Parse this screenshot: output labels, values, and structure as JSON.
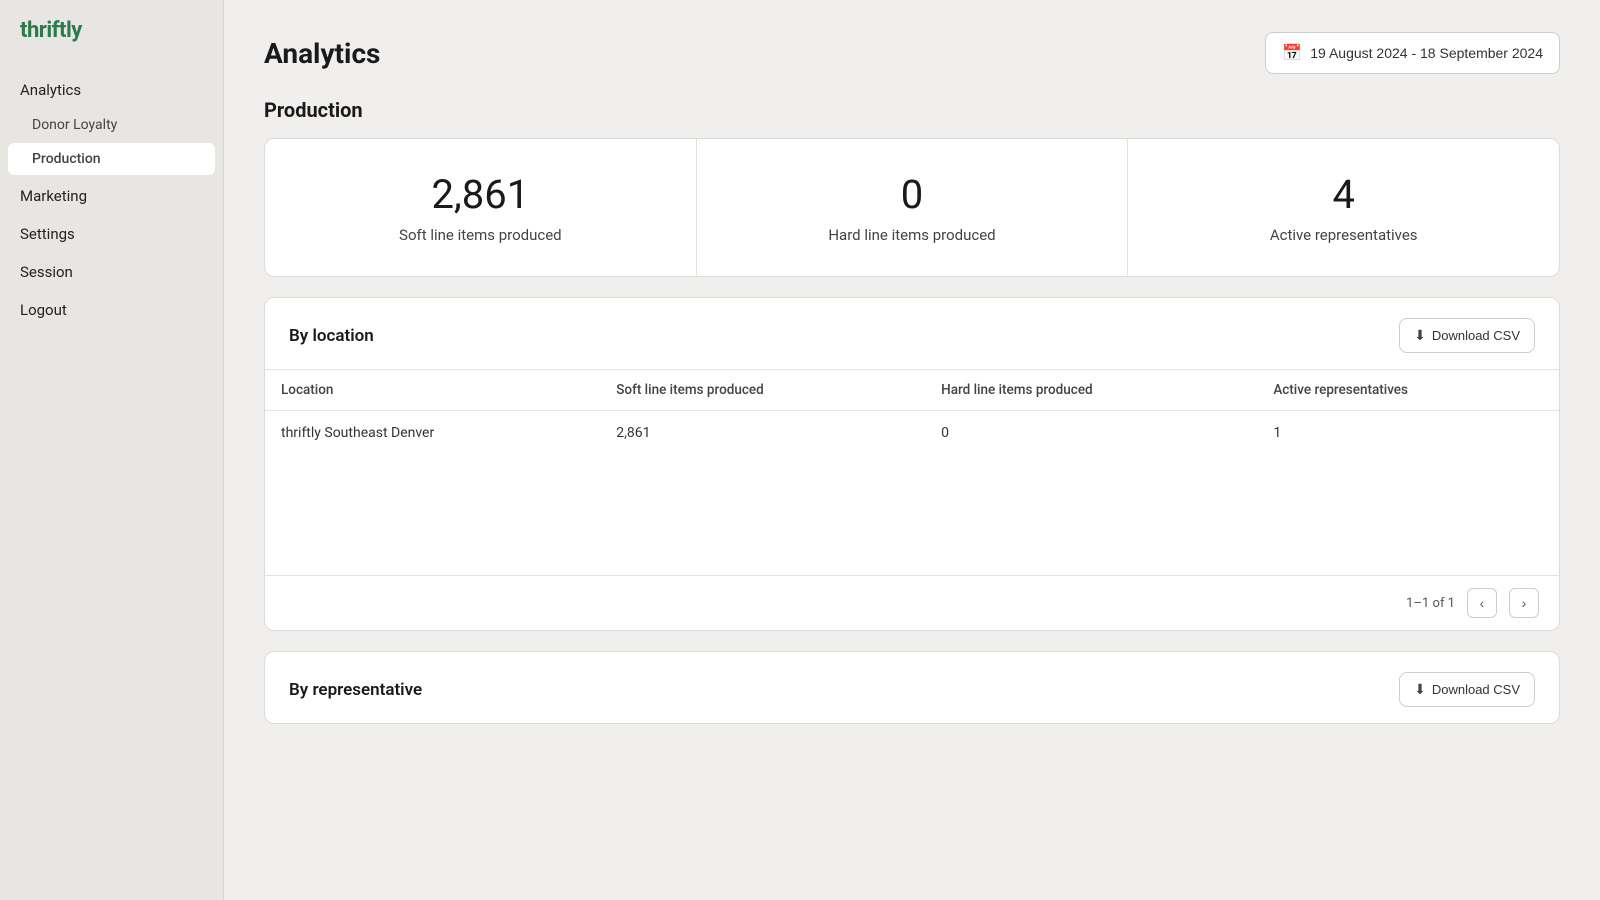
{
  "app": {
    "name": "thriftly"
  },
  "sidebar": {
    "items": [
      {
        "id": "analytics",
        "label": "Analytics",
        "level": "top",
        "active": false
      },
      {
        "id": "donor-loyalty",
        "label": "Donor Loyalty",
        "level": "sub",
        "active": false
      },
      {
        "id": "production",
        "label": "Production",
        "level": "sub",
        "active": true
      },
      {
        "id": "marketing",
        "label": "Marketing",
        "level": "top",
        "active": false
      },
      {
        "id": "settings",
        "label": "Settings",
        "level": "top",
        "active": false
      },
      {
        "id": "session",
        "label": "Session",
        "level": "top",
        "active": false
      },
      {
        "id": "logout",
        "label": "Logout",
        "level": "top",
        "active": false
      }
    ]
  },
  "header": {
    "title": "Analytics",
    "date_range": "19 August 2024 - 18 September 2024",
    "calendar_icon": "📅"
  },
  "production": {
    "section_title": "Production",
    "stats": [
      {
        "value": "2,861",
        "label": "Soft line items produced"
      },
      {
        "value": "0",
        "label": "Hard line items produced"
      },
      {
        "value": "4",
        "label": "Active representatives"
      }
    ]
  },
  "by_location": {
    "title": "By location",
    "download_label": "Download CSV",
    "columns": [
      "Location",
      "Soft line items produced",
      "Hard line items produced",
      "Active representatives"
    ],
    "rows": [
      {
        "location": "thriftly Southeast Denver",
        "soft": "2,861",
        "hard": "0",
        "reps": "1"
      }
    ],
    "pagination": "1–1 of 1"
  },
  "by_representative": {
    "title": "By representative",
    "download_label": "Download CSV"
  }
}
